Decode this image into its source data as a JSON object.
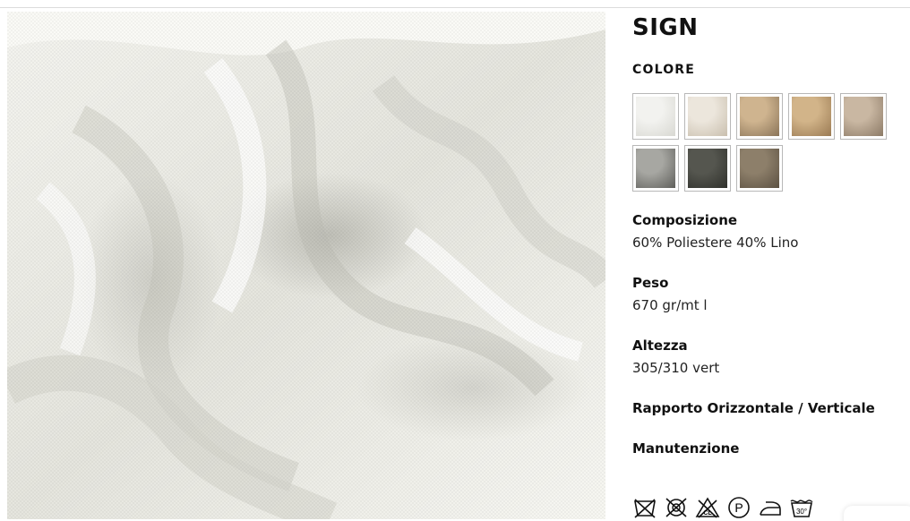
{
  "product": {
    "title": "SIGN",
    "color_label": "COLORE",
    "image_icon": "fabric-photo"
  },
  "swatches": [
    {
      "name": "white",
      "color_a": "#f2f2ef",
      "color_b": "#d8d8d2"
    },
    {
      "name": "cream",
      "color_a": "#ece6dc",
      "color_b": "#c9bfae"
    },
    {
      "name": "sand",
      "color_a": "#cfb48f",
      "color_b": "#8a7458"
    },
    {
      "name": "camel",
      "color_a": "#d2b489",
      "color_b": "#9a7a53"
    },
    {
      "name": "taupe",
      "color_a": "#c9b7a2",
      "color_b": "#8c7a66"
    },
    {
      "name": "grey",
      "color_a": "#a7a7a2",
      "color_b": "#5f5f5b"
    },
    {
      "name": "charcoal",
      "color_a": "#55564f",
      "color_b": "#2f302b"
    },
    {
      "name": "mud",
      "color_a": "#8d7f6a",
      "color_b": "#5c5142"
    }
  ],
  "specs": {
    "composition_label": "Composizione",
    "composition_value": "60% Poliestere 40% Lino",
    "weight_label": "Peso",
    "weight_value": "670 gr/mt l",
    "height_label": "Altezza",
    "height_value": "305/310 vert",
    "repeat_label": "Rapporto Orizzontale / Verticale",
    "care_label": "Manutenzione"
  },
  "care_icons": [
    "no-wash-icon",
    "no-bleach-icon",
    "no-chlorine-icon",
    "dry-clean-p-icon",
    "iron-icon",
    "wash-30-icon"
  ],
  "care_wash_temp": "30°"
}
